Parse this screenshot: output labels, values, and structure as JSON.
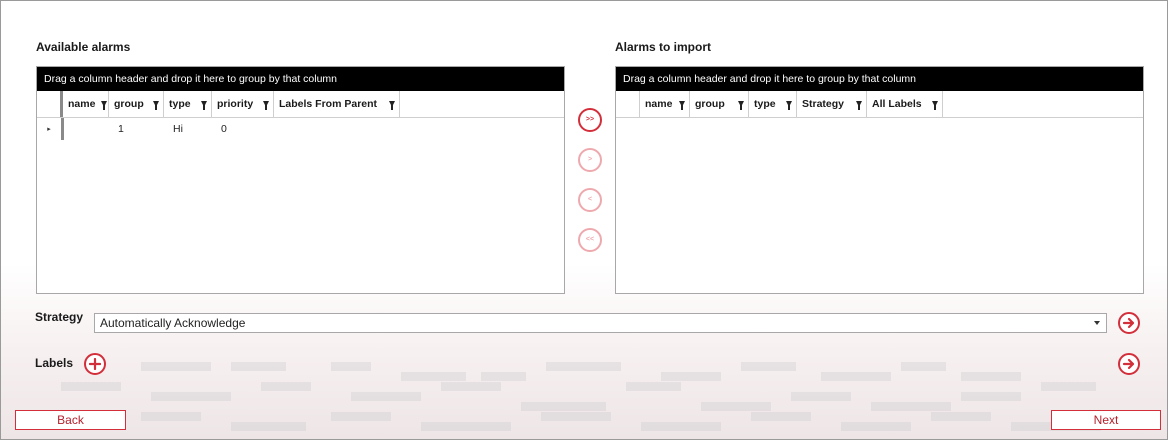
{
  "available": {
    "title": "Available alarms",
    "group_panel": "Drag a column header and drop it here to group by that column",
    "columns": [
      "name",
      "group",
      "type",
      "priority",
      "Labels From Parent"
    ],
    "rows": [
      {
        "indicator": "▸",
        "name": "",
        "group": "1",
        "type": "Hi",
        "priority": "0",
        "labels": ""
      }
    ]
  },
  "import": {
    "title": "Alarms to import",
    "group_panel": "Drag a column header and drop it here to group by that column",
    "columns": [
      "name",
      "group",
      "type",
      "Strategy",
      "All Labels"
    ]
  },
  "move_buttons": {
    "move_all_right": ">>",
    "move_right": ">",
    "move_left": "<",
    "move_all_left": "<<"
  },
  "strategy": {
    "label": "Strategy",
    "value": "Automatically Acknowledge"
  },
  "labels": {
    "label": "Labels"
  },
  "footer": {
    "back_label": "Back",
    "next_label": "Next"
  },
  "colors": {
    "accent": "#d32f3b",
    "accent_disabled": "#eea9ae",
    "header_bar": "#000000"
  },
  "icons": {
    "add": "plus-circle-icon",
    "apply": "arrow-right-circle-icon",
    "filter": "filter-icon",
    "dropdown": "chevron-down-icon"
  }
}
